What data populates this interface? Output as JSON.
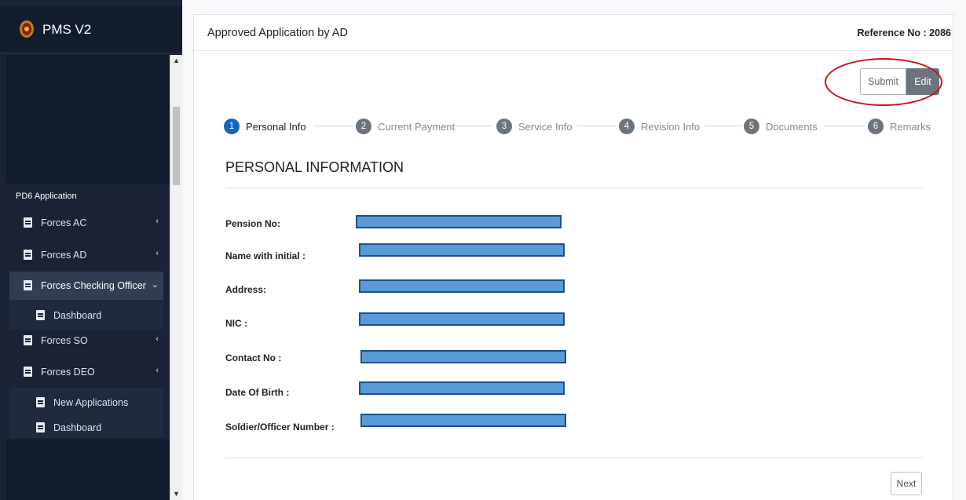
{
  "app": {
    "title": "PMS V2"
  },
  "sidebar": {
    "section_label": "PD6 Application",
    "items": [
      {
        "label": "Forces AC",
        "caret": "‹"
      },
      {
        "label": "Forces AD",
        "caret": "‹"
      },
      {
        "label": "Forces Checking Officer",
        "caret": "⌄"
      },
      {
        "label": "Dashboard"
      },
      {
        "label": "Forces SO",
        "caret": "‹"
      },
      {
        "label": "Forces DEO",
        "caret": "‹"
      },
      {
        "label": "New Applications"
      },
      {
        "label": "Dashboard"
      }
    ]
  },
  "header": {
    "title": "Approved Application by AD",
    "reference": "Reference No : 2086"
  },
  "actions": {
    "submit_label": "Submit",
    "edit_label": "Edit",
    "next_label": "Next"
  },
  "steps": [
    {
      "num": "1",
      "label": "Personal Info",
      "active": true
    },
    {
      "num": "2",
      "label": "Current Payment"
    },
    {
      "num": "3",
      "label": "Service Info"
    },
    {
      "num": "4",
      "label": "Revision Info"
    },
    {
      "num": "5",
      "label": "Documents"
    },
    {
      "num": "6",
      "label": "Remarks"
    }
  ],
  "form": {
    "section_title": "PERSONAL INFORMATION",
    "fields": [
      {
        "label": "Pension No:"
      },
      {
        "label": "Name with initial :"
      },
      {
        "label": "Address:"
      },
      {
        "label": "NIC :"
      },
      {
        "label": "Contact No :"
      },
      {
        "label": "Date Of Birth :"
      },
      {
        "label": "Soldier/Officer Number :"
      }
    ]
  },
  "colors": {
    "sidebar_bg": "#1a2235",
    "active_step": "#1565c0",
    "highlight_ring": "#d01010",
    "redaction": "#5a9ad8"
  }
}
